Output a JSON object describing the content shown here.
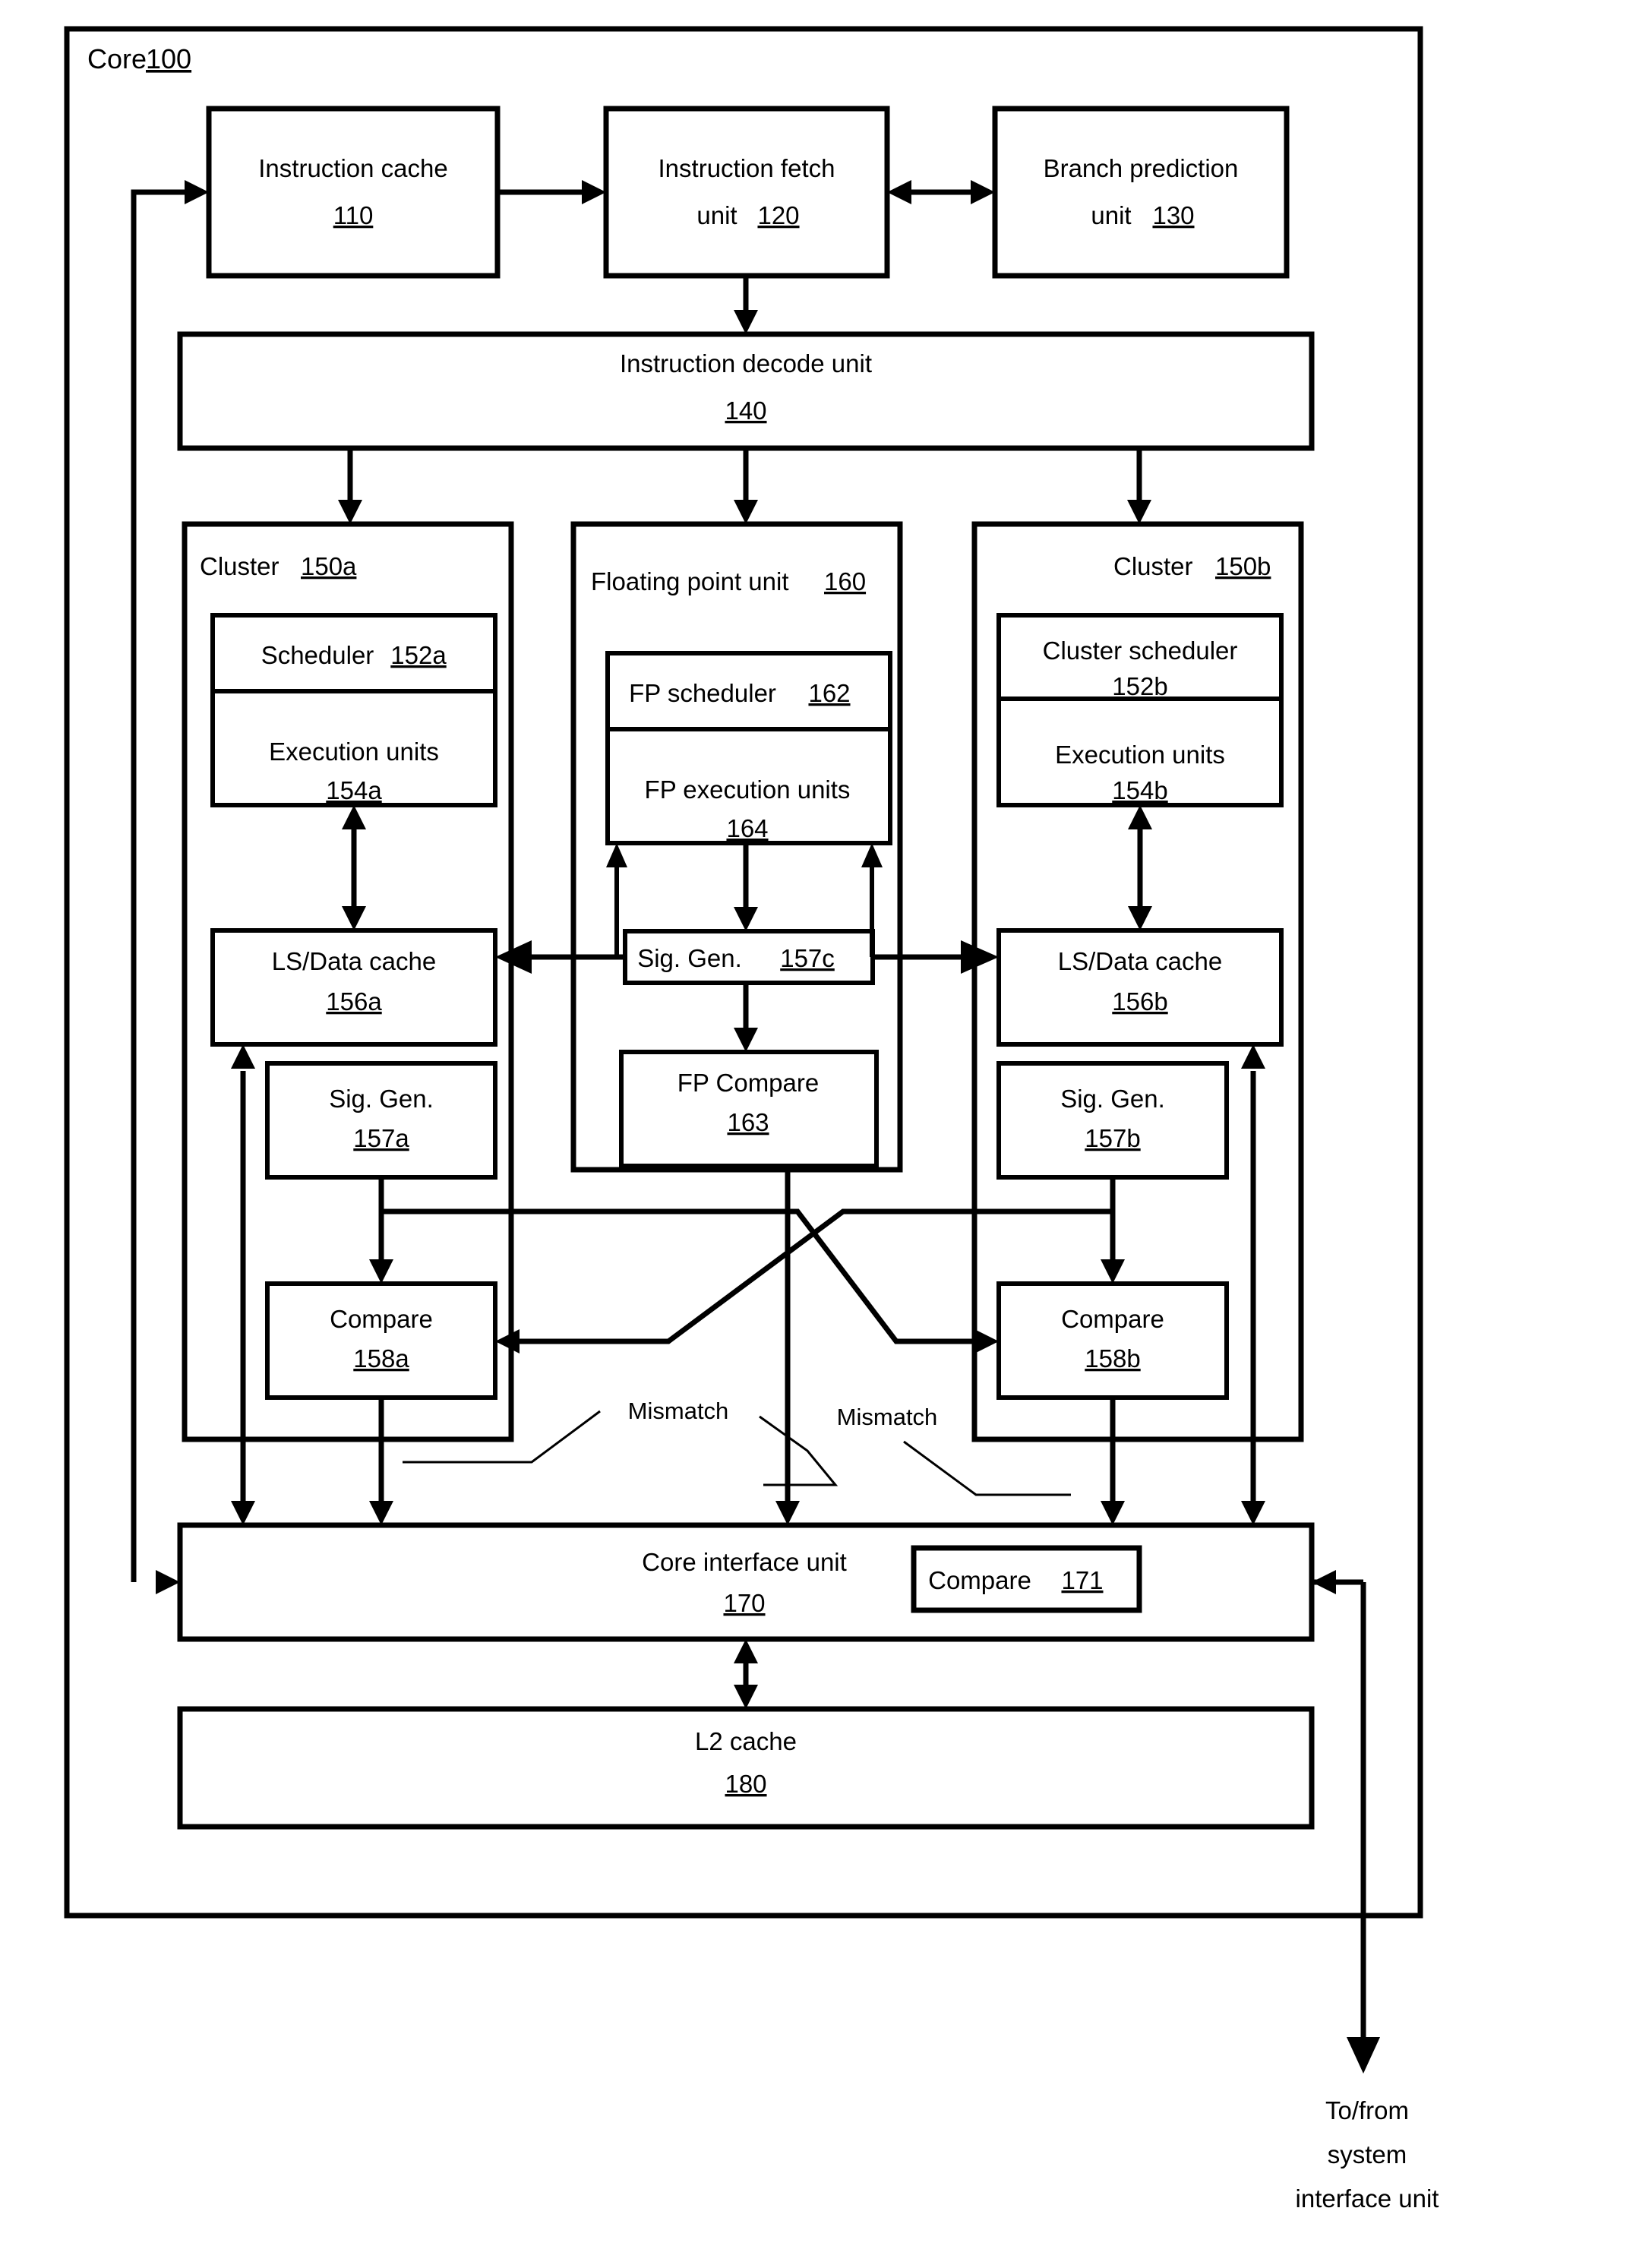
{
  "figure": {
    "title_label": "Core",
    "title_ref": "100"
  },
  "blocks": {
    "instruction_cache": {
      "line1": "Instruction cache",
      "ref": "110"
    },
    "instruction_fetch_unit": {
      "line1": "Instruction fetch",
      "line2": "unit",
      "ref": "120"
    },
    "branch_prediction_unit": {
      "line1": "Branch prediction",
      "line2": "unit",
      "ref": "130"
    },
    "instruction_decode_unit": {
      "line1": "Instruction decode unit",
      "ref": "140"
    },
    "cluster_a": {
      "label": "Cluster",
      "ref": "150a"
    },
    "cluster_b": {
      "label": "Cluster",
      "ref": "150b"
    },
    "floating_point_unit": {
      "label": "Floating point unit",
      "ref": "160"
    },
    "scheduler_a": {
      "label": "Scheduler",
      "ref": "152a"
    },
    "execution_units_a": {
      "line1": "Execution units",
      "ref": "154a"
    },
    "cluster_scheduler_b": {
      "line1": "Cluster scheduler",
      "ref": "152b"
    },
    "execution_units_b": {
      "line1": "Execution units",
      "ref": "154b"
    },
    "fp_scheduler": {
      "label": "FP scheduler",
      "ref": "162"
    },
    "fp_execution_units": {
      "line1": "FP execution units",
      "ref": "164"
    },
    "ls_data_cache_a": {
      "line1": "LS/Data cache",
      "ref": "156a"
    },
    "ls_data_cache_b": {
      "line1": "LS/Data cache",
      "ref": "156b"
    },
    "sig_gen_c": {
      "label": "Sig. Gen.",
      "ref": "157c"
    },
    "sig_gen_a": {
      "line1": "Sig. Gen.",
      "ref": "157a"
    },
    "sig_gen_b": {
      "line1": "Sig. Gen.",
      "ref": "157b"
    },
    "fp_compare": {
      "line1": "FP Compare",
      "ref": "163"
    },
    "compare_a": {
      "line1": "Compare",
      "ref": "158a"
    },
    "compare_b": {
      "line1": "Compare",
      "ref": "158b"
    },
    "core_interface_unit": {
      "line1": "Core interface unit",
      "ref": "170"
    },
    "compare_171": {
      "label": "Compare",
      "ref": "171"
    },
    "l2_cache": {
      "line1": "L2 cache",
      "ref": "180"
    }
  },
  "annotations": {
    "mismatch_left": "Mismatch",
    "mismatch_right": "Mismatch",
    "system_interface": {
      "line1": "To/from",
      "line2": "system",
      "line3": "interface unit"
    }
  },
  "colors": {
    "stroke": "#000000",
    "background": "#ffffff"
  }
}
